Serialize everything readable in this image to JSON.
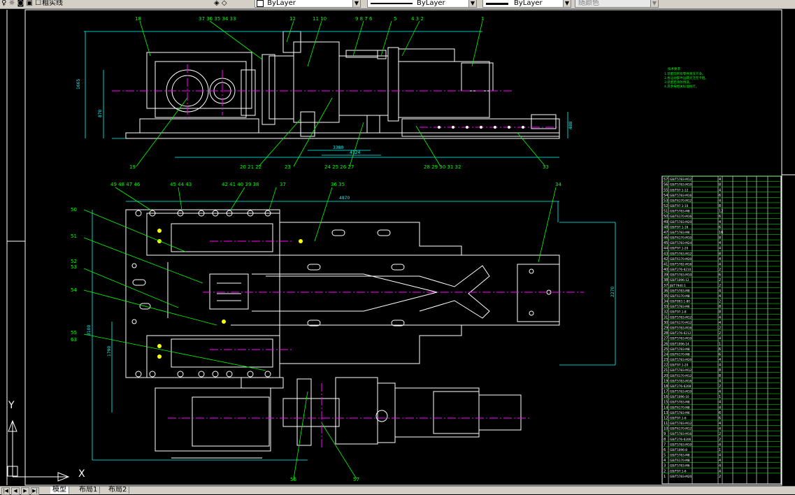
{
  "toolbar": {
    "layer_name": "粗实线",
    "color_value": "ByLayer",
    "linetype_value": "ByLayer",
    "lineweight_value": "ByLayer",
    "plotstyle_value": "随颜色"
  },
  "tabs": [
    {
      "label": "模型"
    },
    {
      "label": "布局1"
    },
    {
      "label": "布局2"
    }
  ],
  "ucs": {
    "x_label": "X",
    "y_label": "Y"
  },
  "colors": {
    "background": "#000000",
    "geometry": "#ffffff",
    "dimension": "#00ffff",
    "leader": "#00ff00",
    "center": "#ff00ff",
    "hatch": "#ffff00"
  },
  "top_view_balloons": [
    "18",
    "37",
    "36",
    "35",
    "34",
    "33",
    "12",
    "11",
    "10",
    "9",
    "8",
    "7",
    "6",
    "5",
    "4",
    "3",
    "2",
    "1"
  ],
  "top_view_bottom_balloons": [
    "19",
    "20",
    "21",
    "22",
    "23",
    "24",
    "25",
    "26",
    "27",
    "28",
    "29",
    "30",
    "31",
    "32",
    "33"
  ],
  "plan_view_top_balloons": [
    "49",
    "48",
    "47",
    "46",
    "45",
    "44",
    "43",
    "42",
    "41",
    "40",
    "39",
    "38",
    "37",
    "36",
    "35",
    "34"
  ],
  "plan_view_left_balloons": [
    "50",
    "51",
    "52",
    "53",
    "54",
    "55",
    "56"
  ],
  "plan_view_bottom_balloons": [
    "56",
    "57"
  ],
  "notes": {
    "title": "技术要求",
    "lines": [
      "1.装配前所有零件清洗干净。",
      "2.各运动部件运转灵活无卡阻。",
      "3.装配后涂防锈漆。",
      "4.其余按相关标准执行。"
    ]
  },
  "dimensions": {
    "top_height": "1665",
    "top_mid": "870",
    "top_width_a": "3380",
    "top_width_b": "4124",
    "right_h": "488",
    "plan_width": "4870",
    "plan_height": "2270",
    "plan_left_h": "3100",
    "plan_left_h2": "1790"
  },
  "parts_list": {
    "rows": [
      {
        "no": "57",
        "name": "GB/T5783-M12",
        "qty": "4"
      },
      {
        "no": "56",
        "name": "GB/T5783-M10",
        "qty": "8"
      },
      {
        "no": "55",
        "name": "GB/T97.1-12",
        "qty": "4"
      },
      {
        "no": "54",
        "name": "GB/T5783-M16",
        "qty": "6"
      },
      {
        "no": "53",
        "name": "GB/T6170-M12",
        "qty": "4"
      },
      {
        "no": "52",
        "name": "GB/T97.1-10",
        "qty": "8"
      },
      {
        "no": "51",
        "name": "GB/T5783-M8",
        "qty": "12"
      },
      {
        "no": "50",
        "name": "GB/T6170-M16",
        "qty": "6"
      },
      {
        "no": "49",
        "name": "GB/T5783-M20",
        "qty": "4"
      },
      {
        "no": "48",
        "name": "GB/T97.1-16",
        "qty": "6"
      },
      {
        "no": "47",
        "name": "GB/T5783-M6",
        "qty": "16"
      },
      {
        "no": "46",
        "name": "GB/T6170-M10",
        "qty": "8"
      },
      {
        "no": "45",
        "name": "GB/T5783-M24",
        "qty": "4"
      },
      {
        "no": "44",
        "name": "GB/T97.1-20",
        "qty": "4"
      },
      {
        "no": "43",
        "name": "GB/T5783-M12",
        "qty": "8"
      },
      {
        "no": "42",
        "name": "GB/T6170-M20",
        "qty": "4"
      },
      {
        "no": "41",
        "name": "GB/T5782-M16",
        "qty": "4"
      },
      {
        "no": "40",
        "name": "GB/T276-6210",
        "qty": "2"
      },
      {
        "no": "39",
        "name": "GB/T5783-M10",
        "qty": "6"
      },
      {
        "no": "38",
        "name": "GB/T1096-12",
        "qty": "2"
      },
      {
        "no": "37",
        "name": "JB/T7940.1",
        "qty": "2"
      },
      {
        "no": "36",
        "name": "GB/T5783-M8",
        "qty": "4"
      },
      {
        "no": "35",
        "name": "GB/T6170-M8",
        "qty": "4"
      },
      {
        "no": "34",
        "name": "GB/T893.1-80",
        "qty": "2"
      },
      {
        "no": "33",
        "name": "GB/T5783-M6",
        "qty": "8"
      },
      {
        "no": "32",
        "name": "GB/T97.1-8",
        "qty": "8"
      },
      {
        "no": "31",
        "name": "GB/T5783-M12",
        "qty": "4"
      },
      {
        "no": "30",
        "name": "GB/T6170-M12",
        "qty": "4"
      },
      {
        "no": "29",
        "name": "GB/T5783-M16",
        "qty": "2"
      },
      {
        "no": "28",
        "name": "GB/T276-6212",
        "qty": "2"
      },
      {
        "no": "27",
        "name": "GB/T5783-M10",
        "qty": "4"
      },
      {
        "no": "26",
        "name": "GB/T1096-14",
        "qty": "1"
      },
      {
        "no": "25",
        "name": "GB/T5783-M8",
        "qty": "6"
      },
      {
        "no": "24",
        "name": "GB/T6170-M8",
        "qty": "6"
      },
      {
        "no": "23",
        "name": "GB/T5783-M20",
        "qty": "4"
      },
      {
        "no": "22",
        "name": "GB/T97.1-20",
        "qty": "4"
      },
      {
        "no": "21",
        "name": "GB/T5783-M12",
        "qty": "8"
      },
      {
        "no": "20",
        "name": "GB/T6170-M12",
        "qty": "8"
      },
      {
        "no": "19",
        "name": "GB/T5783-M16",
        "qty": "4"
      },
      {
        "no": "18",
        "name": "GB/T276-6208",
        "qty": "2"
      },
      {
        "no": "17",
        "name": "GB/T5783-M10",
        "qty": "4"
      },
      {
        "no": "16",
        "name": "GB/T1096-10",
        "qty": "1"
      },
      {
        "no": "15",
        "name": "GB/T5783-M8",
        "qty": "4"
      },
      {
        "no": "14",
        "name": "GB/T6170-M8",
        "qty": "4"
      },
      {
        "no": "13",
        "name": "GB/T5783-M6",
        "qty": "6"
      },
      {
        "no": "12",
        "name": "GB/T97.1-6",
        "qty": "6"
      },
      {
        "no": "11",
        "name": "GB/T5783-M12",
        "qty": "4"
      },
      {
        "no": "10",
        "name": "GB/T6170-M12",
        "qty": "4"
      },
      {
        "no": "9",
        "name": "GB/T5783-M16",
        "qty": "2"
      },
      {
        "no": "8",
        "name": "GB/T276-6206",
        "qty": "2"
      },
      {
        "no": "7",
        "name": "GB/T5783-M10",
        "qty": "4"
      },
      {
        "no": "6",
        "name": "GB/T1096-8",
        "qty": "1"
      },
      {
        "no": "5",
        "name": "GB/T5783-M8",
        "qty": "4"
      },
      {
        "no": "4",
        "name": "GB/T6170-M8",
        "qty": "4"
      },
      {
        "no": "3",
        "name": "GB/T5783-M6",
        "qty": "4"
      },
      {
        "no": "2",
        "name": "GB/T97.1-6",
        "qty": "4"
      },
      {
        "no": "1",
        "name": "GB/T5783-M20",
        "qty": "2"
      }
    ]
  }
}
